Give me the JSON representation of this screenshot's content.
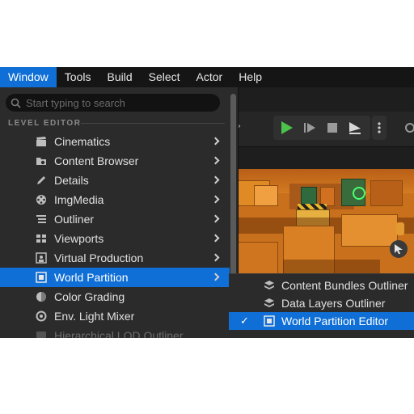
{
  "menubar": {
    "items": [
      {
        "label": "Window",
        "active": true
      },
      {
        "label": "Tools"
      },
      {
        "label": "Build"
      },
      {
        "label": "Select"
      },
      {
        "label": "Actor"
      },
      {
        "label": "Help"
      }
    ]
  },
  "search": {
    "placeholder": "Start typing to search"
  },
  "section_header": "LEVEL EDITOR",
  "menu_items": [
    {
      "label": "Cinematics",
      "icon": "clapperboard-icon",
      "has_submenu": true
    },
    {
      "label": "Content Browser",
      "icon": "folder-search-icon",
      "has_submenu": true
    },
    {
      "label": "Details",
      "icon": "pencil-icon",
      "has_submenu": true
    },
    {
      "label": "ImgMedia",
      "icon": "film-reel-icon",
      "has_submenu": true
    },
    {
      "label": "Outliner",
      "icon": "list-icon",
      "has_submenu": true
    },
    {
      "label": "Viewports",
      "icon": "viewport-grid-icon",
      "has_submenu": true
    },
    {
      "label": "Virtual Production",
      "icon": "presenter-icon",
      "has_submenu": true
    },
    {
      "label": "World Partition",
      "icon": "world-partition-icon",
      "has_submenu": true,
      "selected": true
    },
    {
      "label": "Color Grading",
      "icon": "color-wheel-icon"
    },
    {
      "label": "Env. Light Mixer",
      "icon": "light-mixer-icon"
    },
    {
      "label": "Hierarchical LOD Outliner",
      "icon": "lod-icon",
      "dimmed": true
    }
  ],
  "submenu_items": [
    {
      "label": "Content Bundles Outliner",
      "icon": "layers-icon"
    },
    {
      "label": "Data Layers Outliner",
      "icon": "layers-icon"
    },
    {
      "label": "World Partition Editor",
      "icon": "world-partition-icon",
      "checked": true,
      "selected": true
    }
  ],
  "submenu_check": "✓",
  "colors": {
    "accent": "#0f6fd6",
    "play_green": "#4cc24c",
    "menu_bg": "#2b2b2b"
  }
}
